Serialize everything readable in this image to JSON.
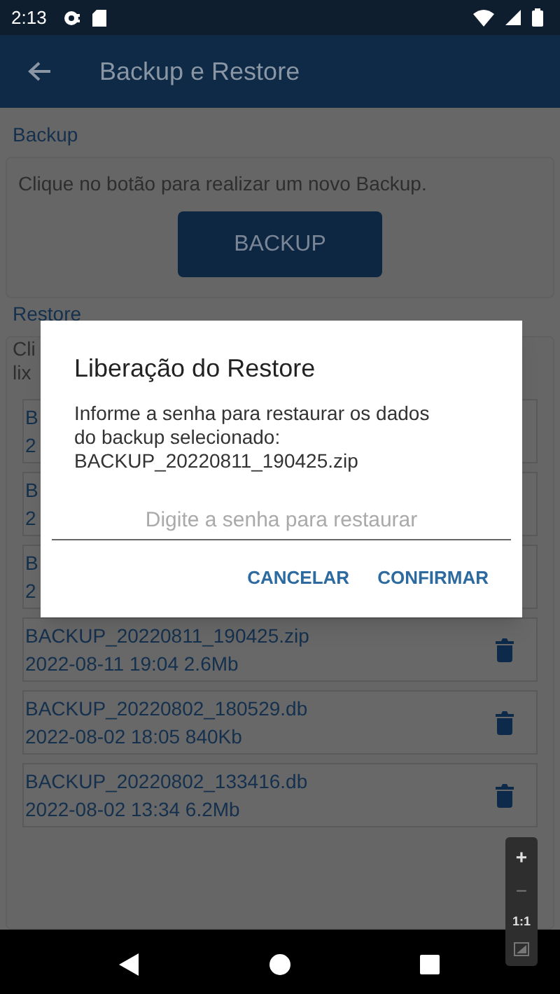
{
  "status_bar": {
    "time": "2:13"
  },
  "app_bar": {
    "title": "Backup e Restore"
  },
  "backup": {
    "heading": "Backup",
    "description": "Clique no botão para realizar um novo Backup.",
    "button": "BACKUP"
  },
  "restore": {
    "heading": "Restore",
    "description": "Cli\nlix",
    "files_behind_dialog": [
      {
        "name": "B",
        "info": "2"
      },
      {
        "name": "B",
        "info": "2"
      },
      {
        "name": "B",
        "info": "2"
      }
    ],
    "files": [
      {
        "name": "BACKUP_20220811_190425.zip",
        "info": "2022-08-11 19:04 2.6Mb"
      },
      {
        "name": "BACKUP_20220802_180529.db",
        "info": "2022-08-02 18:05 840Kb"
      },
      {
        "name": "BACKUP_20220802_133416.db",
        "info": "2022-08-02 13:34 6.2Mb"
      }
    ]
  },
  "dialog": {
    "title": "Liberação do Restore",
    "message": "Informe a senha para restaurar os dados\ndo backup selecionado:\nBACKUP_20220811_190425.zip",
    "placeholder": "Digite a senha para restaurar",
    "buttons": [
      "CANCELAR",
      "CONFIRMAR"
    ]
  },
  "zoom_controls": [
    "+",
    "−",
    "1:1"
  ]
}
